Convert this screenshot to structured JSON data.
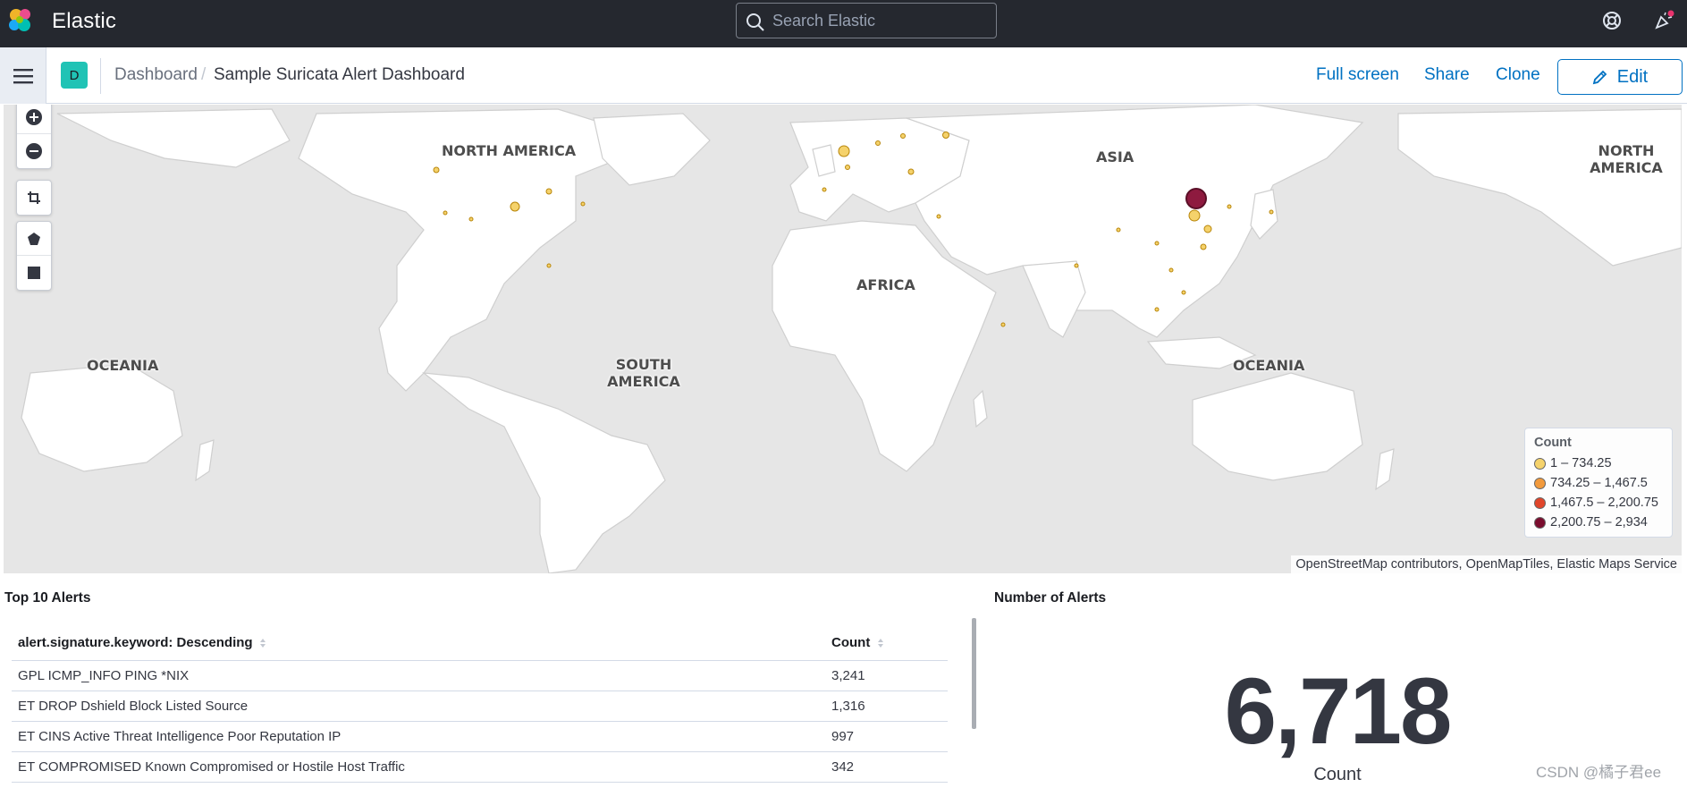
{
  "header": {
    "brand": "Elastic",
    "search_placeholder": "Search Elastic"
  },
  "subheader": {
    "space_initial": "D",
    "breadcrumbs": [
      "Dashboard",
      "Sample Suricata Alert Dashboard"
    ],
    "actions": {
      "full_screen": "Full screen",
      "share": "Share",
      "clone": "Clone",
      "edit": "Edit"
    }
  },
  "map": {
    "continents": [
      "NORTH AMERICA",
      "ASIA",
      "NORTH AMERICA",
      "AFRICA",
      "OCEANIA",
      "SOUTH AMERICA",
      "OCEANIA"
    ],
    "legend": {
      "title": "Count",
      "items": [
        {
          "label": "1 – 734.25",
          "color": "#f5d26b"
        },
        {
          "label": "734.25 – 1,467.5",
          "color": "#f29a3c"
        },
        {
          "label": "1,467.5 – 2,200.75",
          "color": "#e0452a"
        },
        {
          "label": "2,200.75 – 2,934",
          "color": "#7a0d2e"
        }
      ]
    },
    "attribution": "OpenStreetMap contributors, OpenMapTiles, Elastic Maps Service"
  },
  "top_alerts": {
    "title": "Top 10 Alerts",
    "columns": [
      "alert.signature.keyword: Descending",
      "Count"
    ],
    "rows": [
      [
        "GPL ICMP_INFO PING *NIX",
        "3,241"
      ],
      [
        "ET DROP Dshield Block Listed Source",
        "1,316"
      ],
      [
        "ET CINS Active Threat Intelligence Poor Reputation IP",
        "997"
      ],
      [
        "ET COMPROMISED Known Compromised or Hostile Host Traffic",
        "342"
      ]
    ]
  },
  "number_of_alerts": {
    "title": "Number of Alerts",
    "value": "6,718",
    "label": "Count"
  },
  "watermark": "CSDN @橘子君ee"
}
